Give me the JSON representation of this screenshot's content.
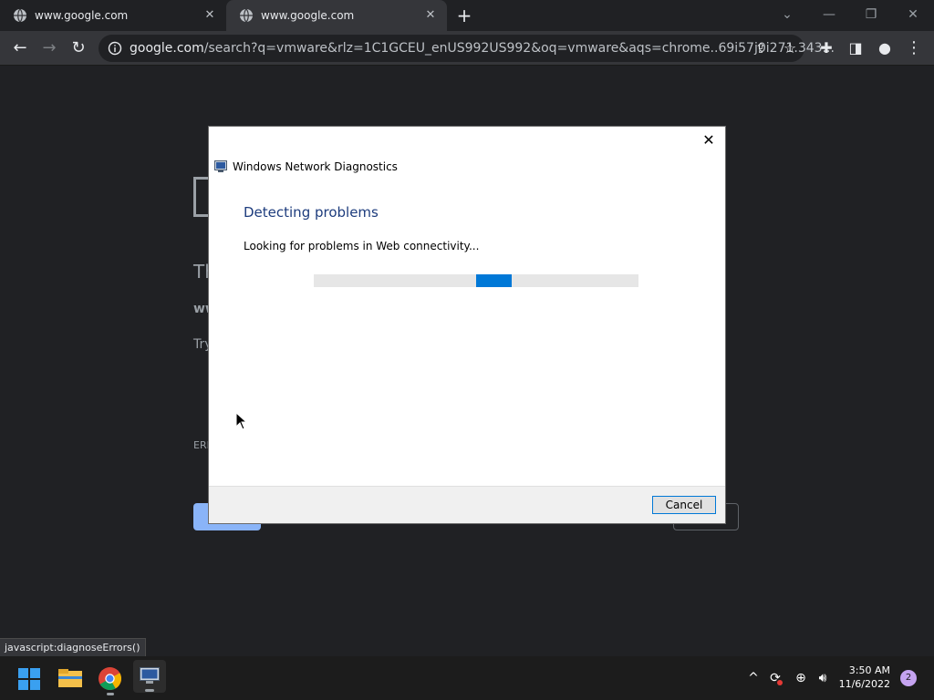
{
  "browser": {
    "tabs": [
      {
        "title": "www.google.com"
      },
      {
        "title": "www.google.com"
      }
    ],
    "address": {
      "host": "google.com",
      "path": "/search?q=vmware&rlz=1C1GCEU_enUS992US992&oq=vmware&aqs=chrome..69i57j0i271.343..."
    }
  },
  "page": {
    "error_code_prefix": "ERR",
    "partial_title": "Th",
    "partial_host": "ww",
    "partial_try": "Try"
  },
  "dialog": {
    "title": "Windows Network Diagnostics",
    "heading": "Detecting problems",
    "status": "Looking for problems in Web connectivity...",
    "cancel_label": "Cancel"
  },
  "statusbar": {
    "text": "javascript:diagnoseErrors()"
  },
  "taskbar": {
    "time": "3:50 AM",
    "date": "11/6/2022",
    "notification_count": "2"
  }
}
